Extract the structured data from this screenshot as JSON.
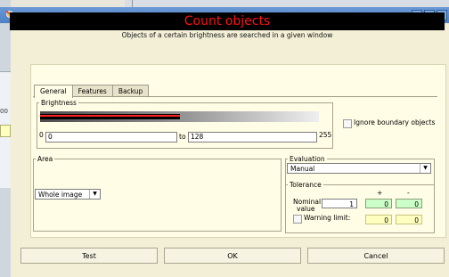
{
  "window": {
    "app_icon": "app-logo-icon",
    "minimize": "_",
    "maximize": "□",
    "close": "×"
  },
  "background": {
    "tick_label": "00"
  },
  "header": {
    "title": "Count objects",
    "subtitle": "Objects of a certain brightness are searched in a given window"
  },
  "tabs": [
    {
      "label": "General",
      "active": true
    },
    {
      "label": "Features",
      "active": false
    },
    {
      "label": "Backup",
      "active": false
    }
  ],
  "brightness": {
    "group_label": "Brightness",
    "min_scale": "0",
    "max_scale": "255",
    "from_value": "0",
    "to_label": "to",
    "to_value": "128",
    "ignore_boundary_label": "Ignore boundary objects",
    "ignore_boundary_checked": false
  },
  "area": {
    "group_label": "Area",
    "selected": "Whole image"
  },
  "evaluation": {
    "group_label": "Evaluation",
    "selected": "Manual",
    "tolerance": {
      "group_label": "Tolerance",
      "plus_label": "+",
      "minus_label": "-",
      "nominal_label_1": "Nominal",
      "nominal_label_2": "value",
      "nominal_value": "1",
      "nominal_plus": "0",
      "nominal_minus": "0",
      "warning_label": "Warning limit:",
      "warning_checked": false,
      "warning_plus": "0",
      "warning_minus": "0"
    }
  },
  "buttons": {
    "test": "Test",
    "ok": "OK",
    "cancel": "Cancel"
  },
  "colors": {
    "header_bg": "#000000",
    "header_text": "#ff1010",
    "card_bg": "#fffde6",
    "green_box": "#ccffc8",
    "yellow_box": "#ffffc0"
  }
}
